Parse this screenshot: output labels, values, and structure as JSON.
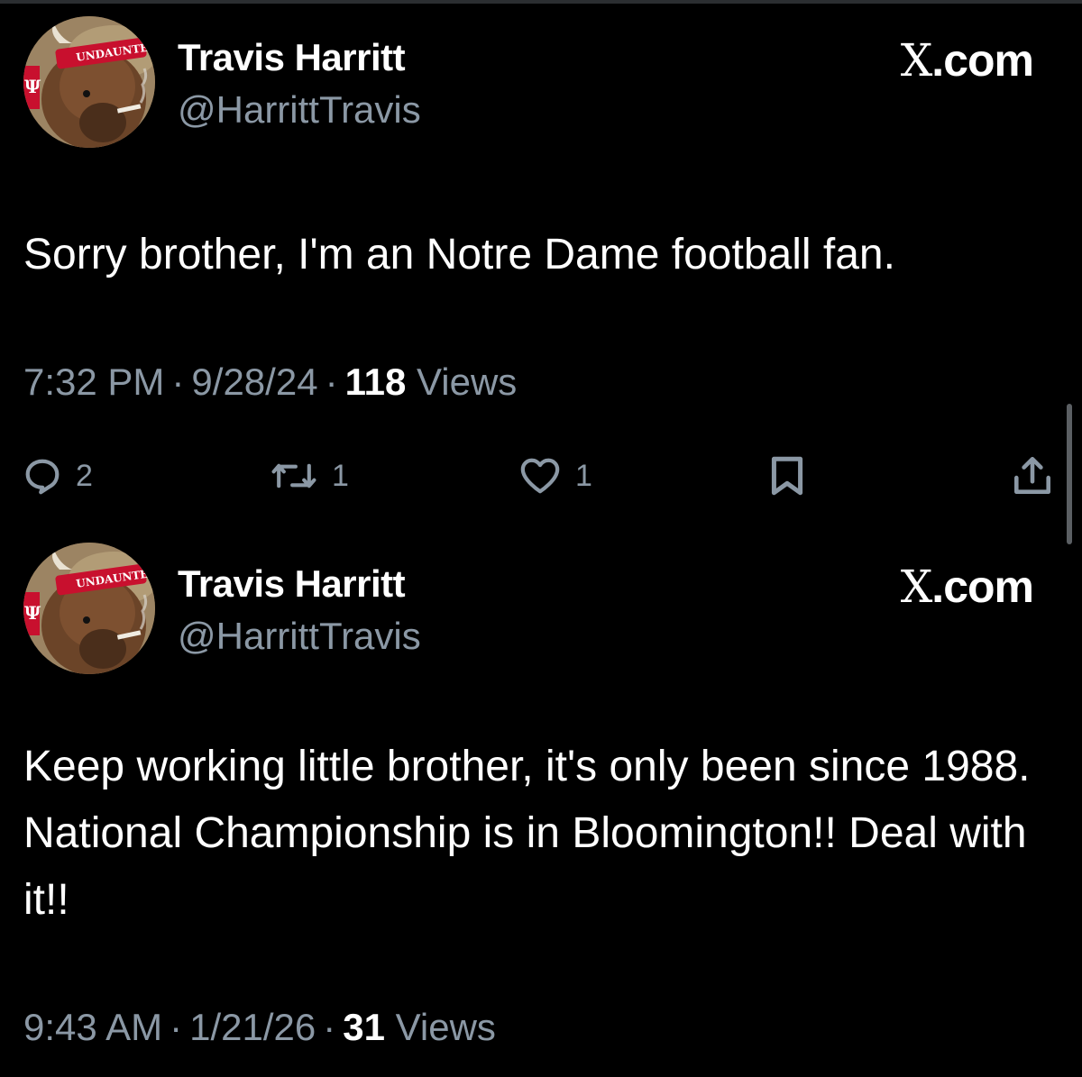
{
  "tweets": [
    {
      "author": {
        "name": "Travis Harritt",
        "handle": "@HarrittTravis",
        "avatar_badge_text": "UNDAUNTED"
      },
      "brand": "X.com",
      "text": "Sorry brother, I'm an Notre Dame football fan.",
      "meta": {
        "time": "7:32 PM",
        "date": "9/28/24",
        "views_count": "118",
        "views_label": "Views"
      },
      "actions": {
        "replies": "2",
        "reposts": "1",
        "likes": "1"
      }
    },
    {
      "author": {
        "name": "Travis Harritt",
        "handle": "@HarrittTravis",
        "avatar_badge_text": "UNDAUNTED"
      },
      "brand": "X.com",
      "text": "Keep working little brother, it's only been since 1988. National Championship is in Bloomington!! Deal with it!!",
      "meta": {
        "time": "9:43 AM",
        "date": "1/21/26",
        "views_count": "31",
        "views_label": "Views"
      }
    }
  ],
  "icons": {
    "reply": "reply-icon",
    "repost": "repost-icon",
    "like": "heart-icon",
    "bookmark": "bookmark-icon",
    "share": "share-icon"
  },
  "colors": {
    "background": "#000000",
    "primary_text": "#ffffff",
    "secondary_text": "#8b98a5",
    "avatar_headband": "#c8102e"
  }
}
